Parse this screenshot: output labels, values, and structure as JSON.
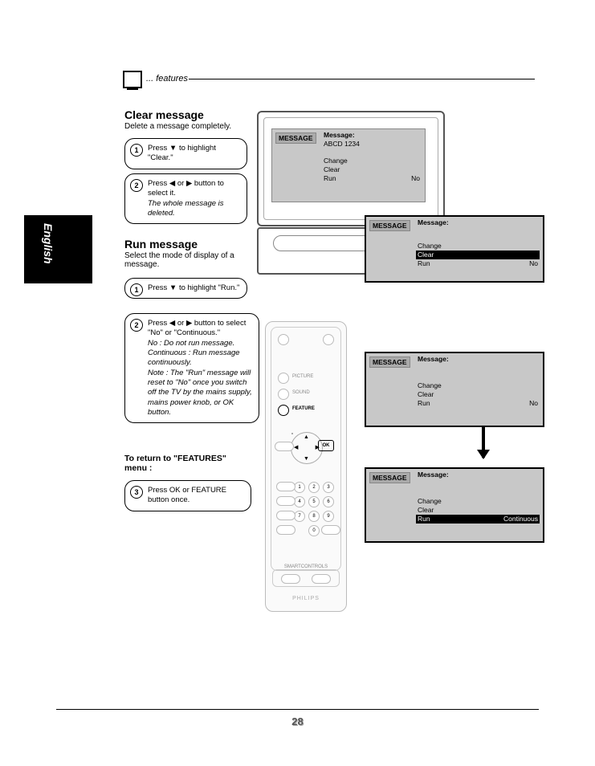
{
  "header": {
    "features": "... features"
  },
  "tab": {
    "english": "English"
  },
  "clear": {
    "title": "Clear message",
    "subtitle": "Delete a message completely.",
    "step1": "Press ▼ to highlight \"Clear.\"",
    "step2_a": "Press ◀ or ▶ button to select it.",
    "step2_b": "The whole message is deleted."
  },
  "run": {
    "title": "Run message",
    "subtitle": "Select the mode of display of a message.",
    "step1": "Press ▼ to highlight \"Run.\"",
    "step2_a": "Press ◀ or ▶ button to select \"No\" or \"Continuous.\"",
    "step2_b": "No : Do not run message.",
    "step2_c": "Continuous : Run message continuously.",
    "step2_d": "Note : The \"Run\" message will reset to \"No\" once you switch off the TV by the mains supply, mains power knob, or OK button."
  },
  "return": {
    "title": "To return to \"FEATURES\" menu :",
    "step3": "Press OK or FEATURE button once."
  },
  "osd": {
    "label": "MESSAGE",
    "msg": "Message:",
    "abcd": "ABCD 1234",
    "change": "Change",
    "clear": "Clear",
    "run": "Run",
    "no": "No",
    "continuous": "Continuous"
  },
  "remote": {
    "picture": "PICTURE",
    "sound": "SOUND",
    "feature": "FEATURE",
    "ok": "OK",
    "brand": "PHILIPS",
    "smart": "SMARTCONTROLS"
  },
  "page": "28"
}
